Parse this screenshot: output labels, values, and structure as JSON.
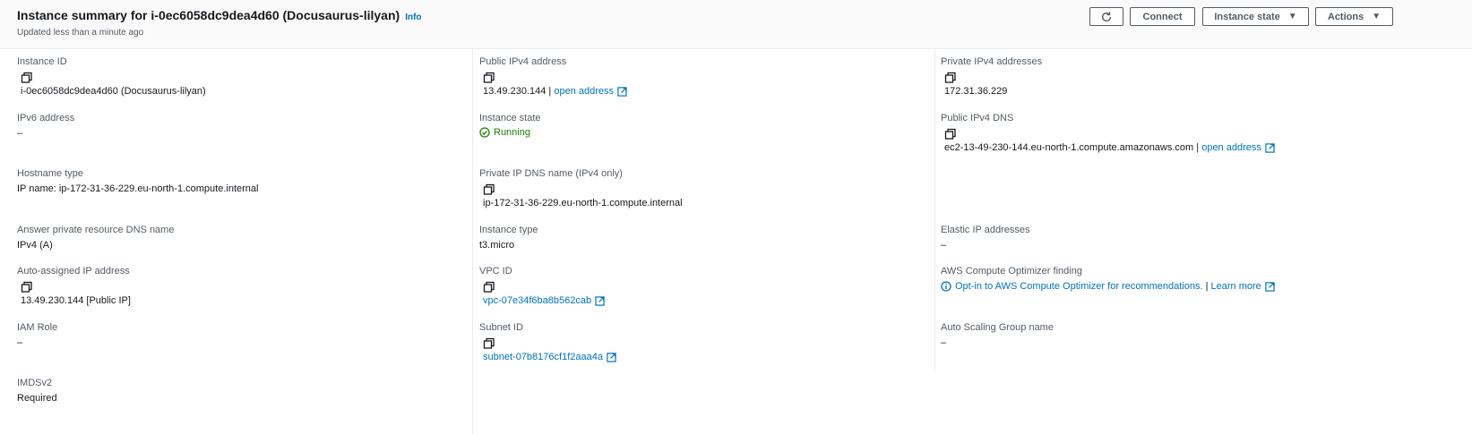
{
  "header": {
    "title": "Instance summary for i-0ec6058dc9dea4d60 (Docusaurus-lilyan)",
    "info": "Info",
    "updated": "Updated less than a minute ago",
    "buttons": {
      "refresh_icon": "refresh-icon",
      "connect": "Connect",
      "instance_state": "Instance state",
      "actions": "Actions"
    }
  },
  "col1": {
    "instance_id": {
      "label": "Instance ID",
      "value": "i-0ec6058dc9dea4d60 (Docusaurus-lilyan)"
    },
    "ipv6": {
      "label": "IPv6 address",
      "value": "–"
    },
    "hostname_type": {
      "label": "Hostname type",
      "value": "IP name: ip-172-31-36-229.eu-north-1.compute.internal"
    },
    "answer_dns": {
      "label": "Answer private resource DNS name",
      "value": "IPv4 (A)"
    },
    "auto_ip": {
      "label": "Auto-assigned IP address",
      "value": "13.49.230.144 [Public IP]"
    },
    "iam_role": {
      "label": "IAM Role",
      "value": "–"
    },
    "imdsv2": {
      "label": "IMDSv2",
      "value": "Required"
    }
  },
  "col2": {
    "public_ipv4": {
      "label": "Public IPv4 address",
      "value": "13.49.230.144",
      "separator": " | ",
      "link": "open address"
    },
    "instance_state": {
      "label": "Instance state",
      "value": "Running"
    },
    "private_ip_dns": {
      "label": "Private IP DNS name (IPv4 only)",
      "value": "ip-172-31-36-229.eu-north-1.compute.internal"
    },
    "instance_type": {
      "label": "Instance type",
      "value": "t3.micro"
    },
    "vpc_id": {
      "label": "VPC ID",
      "value": "vpc-07e34f6ba8b562cab"
    },
    "subnet_id": {
      "label": "Subnet ID",
      "value": "subnet-07b8176cf1f2aaa4a"
    }
  },
  "col3": {
    "private_ipv4": {
      "label": "Private IPv4 addresses",
      "value": "172.31.36.229"
    },
    "public_dns": {
      "label": "Public IPv4 DNS",
      "value": "ec2-13-49-230-144.eu-north-1.compute.amazonaws.com",
      "separator": " | ",
      "link": "open address"
    },
    "elastic_ip": {
      "label": "Elastic IP addresses",
      "value": "–"
    },
    "optimizer": {
      "label": "AWS Compute Optimizer finding",
      "link": "Opt-in to AWS Compute Optimizer for recommendations.",
      "separator": " | ",
      "learn": "Learn more"
    },
    "asg_name": {
      "label": "Auto Scaling Group name",
      "value": "–"
    }
  },
  "colors": {
    "link": "#0073bb",
    "running": "#1d8102",
    "label": "#545b64"
  }
}
